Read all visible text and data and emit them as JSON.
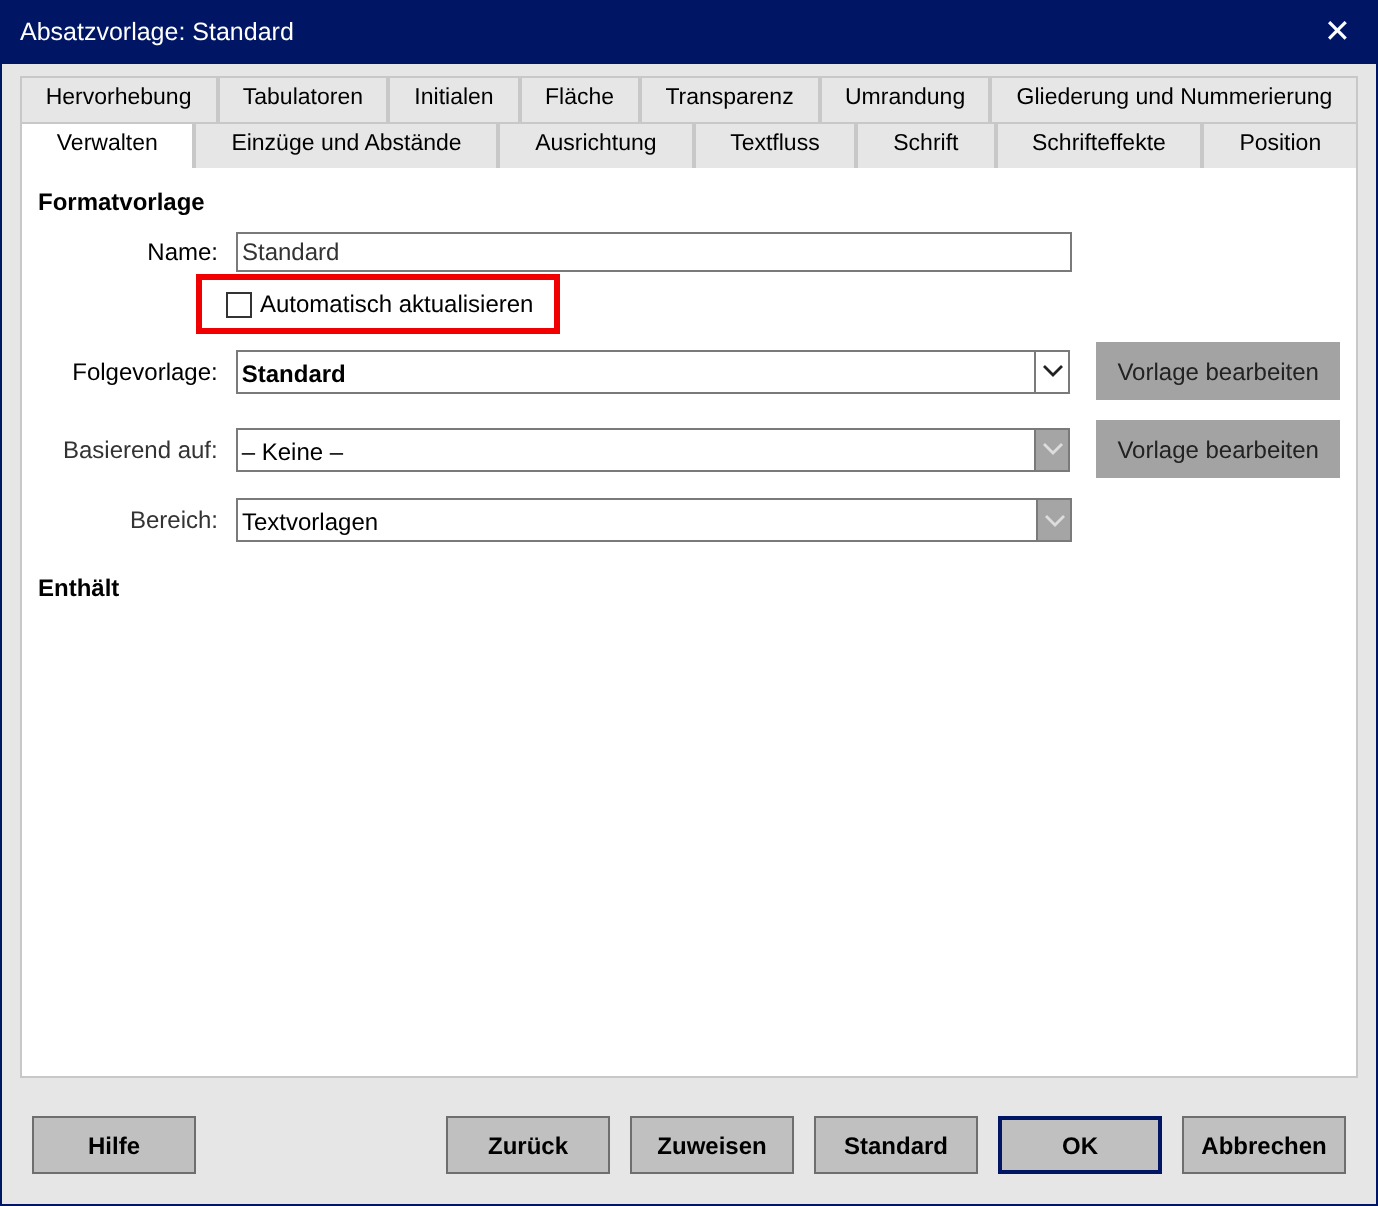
{
  "window": {
    "title": "Absatzvorlage: Standard",
    "close": "✕"
  },
  "tab_rows": [
    [
      {
        "label": "Hervorhebung",
        "selected": false
      },
      {
        "label": "Tabulatoren",
        "selected": false
      },
      {
        "label": "Initialen",
        "selected": false
      },
      {
        "label": "Fläche",
        "selected": false
      },
      {
        "label": "Transparenz",
        "selected": false
      },
      {
        "label": "Umrandung",
        "selected": false
      },
      {
        "label": "Gliederung und Nummerierung",
        "selected": false
      }
    ],
    [
      {
        "label": "Verwalten",
        "selected": true
      },
      {
        "label": "Einzüge und Abstände",
        "selected": false
      },
      {
        "label": "Ausrichtung",
        "selected": false
      },
      {
        "label": "Textfluss",
        "selected": false
      },
      {
        "label": "Schrift",
        "selected": false
      },
      {
        "label": "Schrifteffekte",
        "selected": false
      },
      {
        "label": "Position",
        "selected": false
      }
    ]
  ],
  "section_title": "Formatvorlage",
  "name_field": {
    "label": "Name:",
    "value": "Standard"
  },
  "auto_update": {
    "label": "Automatisch aktualisieren",
    "checked": false,
    "highlighted": true
  },
  "combos": [
    {
      "label": "Folgevorlage:",
      "value": "Standard",
      "focused": true,
      "button": "Vorlage bearbeiten"
    },
    {
      "label": "Basierend auf:",
      "value": "– Keine –",
      "focused": false,
      "button": "Vorlage bearbeiten"
    },
    {
      "label": "Bereich:",
      "value": "Textvorlagen",
      "focused": false
    }
  ],
  "contains_title": "Enthält",
  "left_buttons": [
    {
      "label": "Hilfe",
      "default": false
    }
  ],
  "right_buttons": [
    {
      "label": "Zurück",
      "default": false
    },
    {
      "label": "Zuweisen",
      "default": false
    },
    {
      "label": "Standard",
      "default": false
    },
    {
      "label": "OK",
      "default": true
    },
    {
      "label": "Abbrechen",
      "default": false
    }
  ]
}
